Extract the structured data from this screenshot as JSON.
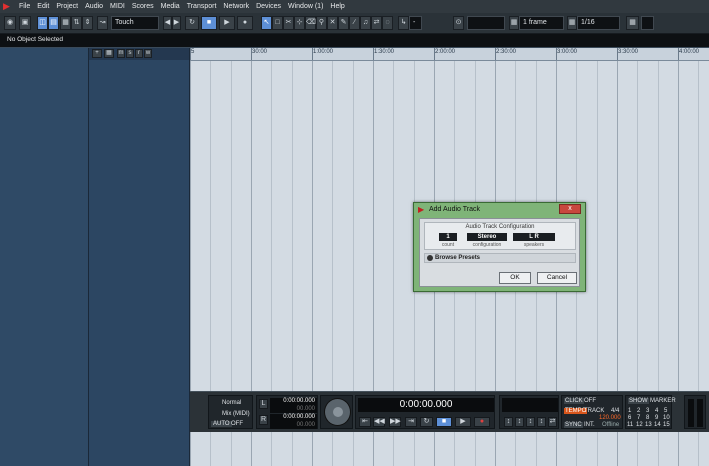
{
  "menubar": {
    "items": [
      "File",
      "Edit",
      "Project",
      "Audio",
      "MIDI",
      "Scores",
      "Media",
      "Transport",
      "Network",
      "Devices",
      "Window (1)",
      "Help"
    ]
  },
  "toolbar": {
    "automation_mode": "Touch",
    "quantize_preset": "1 frame",
    "quantize_value": "1/16",
    "snap_dropdown": "-"
  },
  "infoline": {
    "status": "No Object Selected"
  },
  "ruler": {
    "labels": [
      "5",
      "30:00",
      "1:00:00",
      "1:30:00",
      "2:00:00",
      "2:30:00",
      "3:00:00",
      "3:30:00",
      "4:00:00"
    ]
  },
  "dialog": {
    "title": "Add Audio Track",
    "close_label": "x",
    "config_title": "Audio Track Configuration",
    "count_value": "1",
    "count_label": "count",
    "configuration_value": "Stereo",
    "configuration_label": "configuration",
    "speakers_value": "L R",
    "speakers_label": "speakers",
    "browse_presets": "Browse Presets",
    "ok_label": "OK",
    "cancel_label": "Cancel"
  },
  "transport": {
    "mode_normal": "Normal",
    "mode_mix": "Mix (MIDI)",
    "auto_label": "AUTO",
    "auto_state": "OFF",
    "left_locator": "0:00:00.000",
    "left_locator_small": "00.000",
    "right_locator": "0:00:00.000",
    "right_locator_small": "00.000",
    "main_time": "0:00:00.000",
    "click_label": "CLICK",
    "click_state": "OFF",
    "tempo_label": "TEMPO",
    "track_label": "TRACK",
    "signature": "4/4",
    "tempo_value": "120.000",
    "sync_label": "SYNC",
    "sync_source": "INT.",
    "sync_state": "Offline",
    "show_label": "SHOW",
    "marker_label": "MARKER",
    "markers": [
      "1",
      "2",
      "3",
      "4",
      "5",
      "6",
      "7",
      "8",
      "9",
      "10",
      "11",
      "12",
      "13",
      "14",
      "15"
    ]
  },
  "colors": {
    "inspector": "#2f4a66",
    "grid": "#d3dbe3",
    "dialog_frame": "#7fb478",
    "accent": "#5d8fd6"
  }
}
